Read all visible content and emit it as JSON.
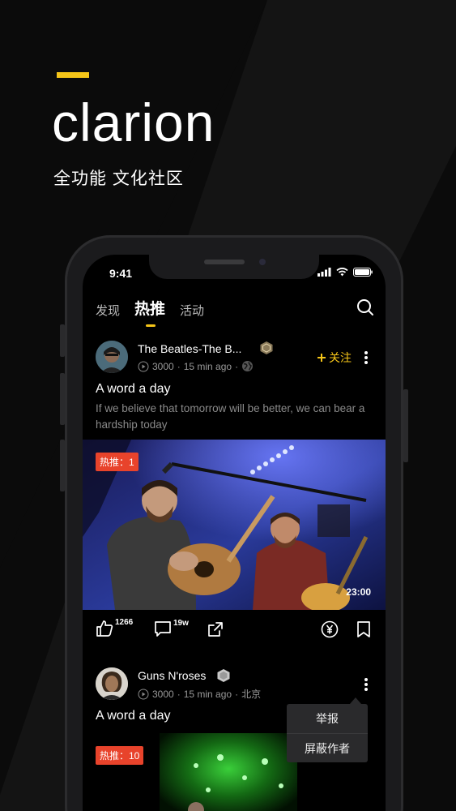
{
  "brand": {
    "name": "clarion",
    "tagline": "全功能 文化社区",
    "accent": "#f5c518"
  },
  "status": {
    "time": "9:41"
  },
  "tabs": [
    {
      "label": "发现",
      "active": false
    },
    {
      "label": "热推",
      "active": true
    },
    {
      "label": "活动",
      "active": false
    }
  ],
  "posts": [
    {
      "username": "The Beatles-The B...",
      "plays": "3000",
      "time_ago": "15 min ago",
      "location": "",
      "follow_label": "关注",
      "title": "A word a day",
      "description": "If we believe that tomorrow will be better, we can bear a hardship today",
      "hot_tag": "热推：1",
      "duration": "23:00",
      "likes": "1266",
      "comments": "19w"
    },
    {
      "username": "Guns N'roses",
      "plays": "3000",
      "time_ago": "15 min ago",
      "location": "北京",
      "title": "A word a day",
      "hot_tag": "热推：10"
    }
  ],
  "menu": {
    "report": "举报",
    "block_author": "屏蔽作者"
  },
  "colors": {
    "hot_tag": "#e8432b",
    "follow": "#f5c518"
  },
  "icons": [
    "search-icon",
    "play-icon",
    "globe-icon",
    "plus-icon",
    "more-icon",
    "like-icon",
    "comment-icon",
    "share-icon",
    "reward-icon",
    "bookmark-icon",
    "signal-icon",
    "wifi-icon",
    "battery-icon"
  ]
}
